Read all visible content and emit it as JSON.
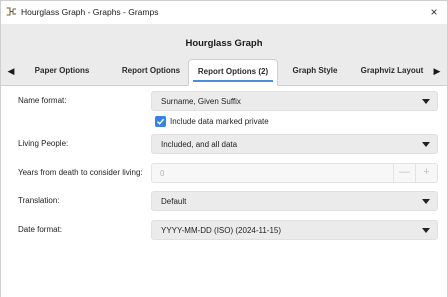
{
  "window": {
    "title": "Hourglass Graph - Graphs - Gramps",
    "close_glyph": "×",
    "app_icon": "gramps-tree-icon"
  },
  "dialog": {
    "title": "Hourglass Graph"
  },
  "tabs": [
    {
      "label": "Paper Options",
      "active": false
    },
    {
      "label": "Report Options",
      "active": false
    },
    {
      "label": "Report Options (2)",
      "active": true
    },
    {
      "label": "Graph Style",
      "active": false
    },
    {
      "label": "Graphviz Layout",
      "active": false
    }
  ],
  "tab_scroll": {
    "left_glyph": "◀",
    "right_glyph": "▶"
  },
  "form": {
    "name_format": {
      "label": "Name format:",
      "value": "Surname, Given Suffix"
    },
    "include_private": {
      "label": "Include data marked private",
      "checked": true
    },
    "living_people": {
      "label": "Living People:",
      "value": "Included, and all data"
    },
    "years_from_death": {
      "label": "Years from death to consider living:",
      "value": "0",
      "minus": "—",
      "plus": "+"
    },
    "translation": {
      "label": "Translation:",
      "value": "Default"
    },
    "date_format": {
      "label": "Date format:",
      "value": "YYYY-MM-DD (ISO) (2024-11-15)"
    }
  },
  "colors": {
    "accent": "#3584e4",
    "header_bg": "#ebebeb",
    "combo_bg": "#ebebeb"
  }
}
